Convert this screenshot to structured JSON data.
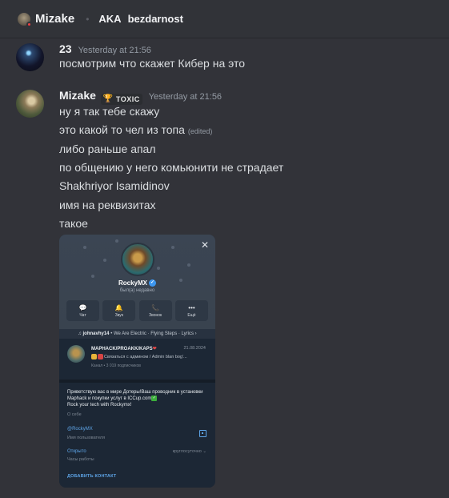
{
  "header": {
    "name": "Mizake",
    "aka_label": "AKA",
    "alias": "bezdarnost"
  },
  "messages": [
    {
      "author": "23",
      "timestamp": "Yesterday at 21:56",
      "lines": [
        "посмотрим что скажет Кибер на это"
      ]
    },
    {
      "author": "Mizake",
      "tag": "TOXIC",
      "timestamp": "Yesterday at 21:56",
      "lines": [
        "ну я так тебе скажу",
        "это какой то чел из топа",
        "либо раньше апал",
        "по общению у него комьюнити не страдает",
        "Shakhriyor Isamidinov",
        "имя на реквизитах",
        "такое"
      ],
      "edited_label": "(edited)"
    }
  ],
  "card": {
    "channel_name": "RockyMX",
    "status": "был(а) недавно",
    "actions": [
      {
        "label": "Чат",
        "icon": "chat-icon"
      },
      {
        "label": "Звук",
        "icon": "bell-icon"
      },
      {
        "label": "Звонок",
        "icon": "phone-icon"
      },
      {
        "label": "Ещё",
        "icon": "more-icon"
      }
    ],
    "music_user": "johnavhy14",
    "music_text": "• We Are Electric · Flying Steps · Lyrics ›",
    "post_title": "MAPHACK/PROAKK/KAPS",
    "post_date": "21.08.2024",
    "post_text": "Связаться с админом / Admin blan bog'...",
    "post_meta": "Канал • 3 019 подписчиков",
    "about_text": "Приветствую вас в мире Дотеры!Ваш проводник в установки Maphack и покупки услуг в ICCup.com",
    "about_text2": "Rock your tech with Rockymx!",
    "about_label": "О себе",
    "username": "@RockyMX",
    "username_label": "Имя пользователя",
    "open_status": "Открыто",
    "hours_value": "круглосуточно",
    "hours_label": "Часы работы",
    "add_contact": "ДОБАВИТЬ КОНТАКТ"
  },
  "colors": {
    "background": "#323339",
    "link": "#5ea5e8",
    "status_dnd": "#f23f43"
  }
}
